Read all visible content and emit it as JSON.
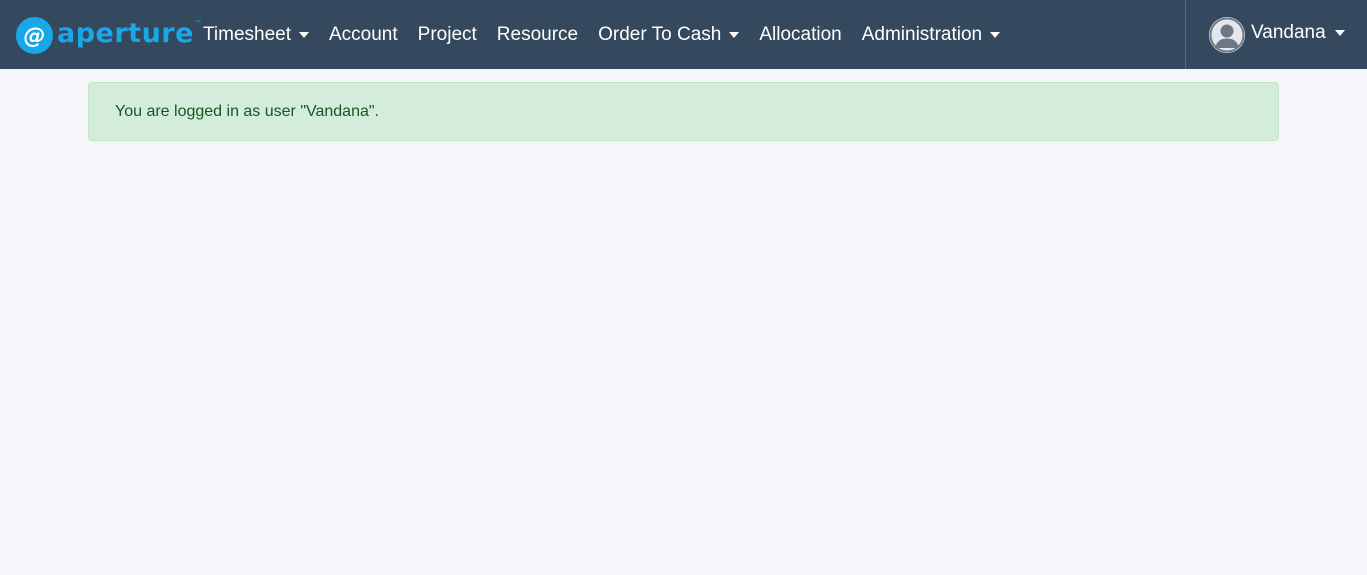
{
  "brand": {
    "name": "aperture",
    "tm": "™",
    "mark_glyph": "@",
    "color": "#19a7e8"
  },
  "nav": {
    "background": "#34495e",
    "items": [
      {
        "label": "Timesheet",
        "dropdown": true
      },
      {
        "label": "Account",
        "dropdown": false
      },
      {
        "label": "Project",
        "dropdown": false
      },
      {
        "label": "Resource",
        "dropdown": false
      },
      {
        "label": "Order To Cash",
        "dropdown": true
      },
      {
        "label": "Allocation",
        "dropdown": false
      },
      {
        "label": "Administration",
        "dropdown": true
      }
    ]
  },
  "user": {
    "name": "Vandana",
    "avatar_icon": "user-avatar-icon",
    "dropdown": true
  },
  "alert": {
    "type": "success",
    "message": "You are logged in as user \"Vandana\".",
    "background": "#d4edda",
    "text_color": "#155724"
  }
}
